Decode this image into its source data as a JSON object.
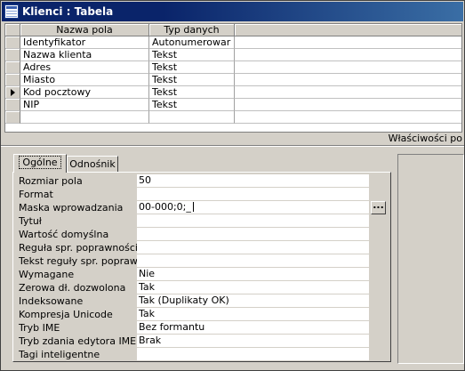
{
  "window": {
    "title": "Klienci : Tabela",
    "icon": "table-icon"
  },
  "grid": {
    "headers": {
      "name": "Nazwa pola",
      "type": "Typ danych",
      "description": ""
    },
    "rows": [
      {
        "name": "Identyfikator",
        "type": "Autonumerowar"
      },
      {
        "name": "Nazwa klienta",
        "type": "Tekst"
      },
      {
        "name": "Adres",
        "type": "Tekst"
      },
      {
        "name": "Miasto",
        "type": "Tekst"
      },
      {
        "name": "Kod pocztowy",
        "type": "Tekst",
        "current": true
      },
      {
        "name": "NIP",
        "type": "Tekst"
      }
    ]
  },
  "properties_label": "Właściwości po",
  "tabs": [
    {
      "label": "Ogólne",
      "active": true
    },
    {
      "label": "Odnośnik",
      "active": false
    }
  ],
  "properties": [
    {
      "label": "Rozmiar pola",
      "value": "50"
    },
    {
      "label": "Format",
      "value": ""
    },
    {
      "label": "Maska wprowadzania",
      "value": "00-000;0;_",
      "focused": true,
      "builder": "..."
    },
    {
      "label": "Tytuł",
      "value": ""
    },
    {
      "label": "Wartość domyślna",
      "value": ""
    },
    {
      "label": "Reguła spr. poprawności",
      "value": ""
    },
    {
      "label": "Tekst reguły spr. poprawr",
      "value": ""
    },
    {
      "label": "Wymagane",
      "value": "Nie"
    },
    {
      "label": "Zerowa dł. dozwolona",
      "value": "Tak"
    },
    {
      "label": "Indeksowane",
      "value": "Tak (Duplikaty OK)"
    },
    {
      "label": "Kompresja Unicode",
      "value": "Tak"
    },
    {
      "label": "Tryb IME",
      "value": "Bez formantu"
    },
    {
      "label": "Tryb zdania edytora IME",
      "value": "Brak"
    },
    {
      "label": "Tagi inteligentne",
      "value": ""
    }
  ],
  "colors": {
    "titlebar": "#0a246a",
    "face": "#d4d0c8"
  }
}
